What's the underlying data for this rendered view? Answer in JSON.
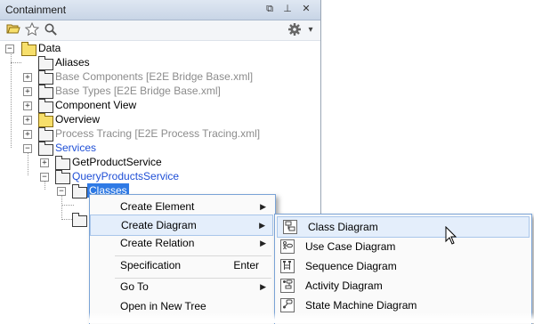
{
  "panel": {
    "title": "Containment",
    "title_buttons": {
      "restore": "⧉",
      "pin": "⊥",
      "close": "✕"
    },
    "toolbar": {
      "open_icon": "folder-open-icon",
      "star_icon": "star-icon",
      "search_icon": "search-icon",
      "gear_icon": "gear-icon",
      "dropdown": "▾"
    }
  },
  "tree": {
    "root": {
      "label": "Data",
      "expander": "−"
    },
    "items": [
      {
        "label": "Aliases"
      },
      {
        "label": "Base Components [E2E Bridge Base.xml]",
        "expander": "+"
      },
      {
        "label": "Base Types [E2E Bridge Base.xml]",
        "expander": "+"
      },
      {
        "label": "Component View",
        "expander": "+"
      },
      {
        "label": "Overview",
        "expander": "+"
      },
      {
        "label": "Process Tracing [E2E Process Tracing.xml]",
        "expander": "+"
      },
      {
        "label": "Services",
        "expander": "−"
      },
      {
        "label": "GetProductService",
        "expander": "+"
      },
      {
        "label": "QueryProductsService",
        "expander": "−"
      },
      {
        "label": "Classes",
        "expander": "−"
      }
    ]
  },
  "context_menu": {
    "items": [
      {
        "label": "Create Element",
        "arrow": "▶"
      },
      {
        "label": "Create Diagram",
        "arrow": "▶"
      },
      {
        "label": "Create Relation",
        "arrow": "▶"
      },
      {
        "label": "Specification",
        "shortcut": "Enter"
      },
      {
        "label": "Go To",
        "arrow": "▶"
      },
      {
        "label": "Open in New Tree"
      }
    ]
  },
  "submenu": {
    "items": [
      {
        "label": "Class Diagram",
        "icon": "class-diagram-icon"
      },
      {
        "label": "Use Case Diagram",
        "icon": "use-case-diagram-icon"
      },
      {
        "label": "Sequence Diagram",
        "icon": "sequence-diagram-icon"
      },
      {
        "label": "Activity Diagram",
        "icon": "activity-diagram-icon"
      },
      {
        "label": "State Machine Diagram",
        "icon": "state-machine-diagram-icon"
      }
    ]
  },
  "colors": {
    "selection": "#2f7ae5",
    "link_blue": "#1f4fd6",
    "disabled_grey": "#8c8c8c",
    "menu_border": "#7aa3d6",
    "highlight": "#e4eefb"
  }
}
